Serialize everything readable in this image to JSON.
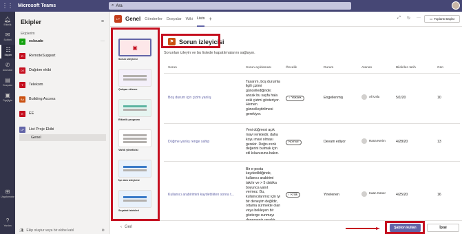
{
  "app": {
    "name": "Microsoft Teams",
    "search_value": "Ara",
    "accent": "#464775",
    "brand": "#6264a7"
  },
  "rail": [
    {
      "icon": "bell-icon",
      "label": "Etkinlik"
    },
    {
      "icon": "chat-icon",
      "label": "Sohbet"
    },
    {
      "icon": "teams-icon",
      "label": "Ekipler"
    },
    {
      "icon": "calls-icon",
      "label": "Aramalar"
    },
    {
      "icon": "files-icon",
      "label": "Dosyalar"
    },
    {
      "icon": "onenote-icon",
      "label": "OneNote"
    },
    {
      "icon": "apps-icon",
      "label": "Uygulamalar"
    },
    {
      "icon": "help-icon",
      "label": "Yardım"
    }
  ],
  "teams_panel": {
    "title": "Ekipler",
    "section": "Ekiplerim",
    "teams": [
      {
        "initials": "e",
        "name": "ecloude",
        "color": "#13a10e",
        "bold": true
      },
      {
        "initials": "R",
        "name": "RemoteSupport",
        "color": "#c50f1f",
        "bold": false
      },
      {
        "initials": "DE",
        "name": "Dağıtım ekibi",
        "color": "#c50f1f",
        "bold": false
      },
      {
        "initials": "T",
        "name": "Telekom",
        "color": "#c50f1f",
        "bold": false
      },
      {
        "initials": "BA",
        "name": "Building Access",
        "color": "#ca5010",
        "bold": false
      },
      {
        "initials": "E",
        "name": "EE",
        "color": "#c50f1f",
        "bold": false
      },
      {
        "initials": "LP",
        "name": "List Proje Ekibi",
        "color": "#6264a7",
        "bold": false
      }
    ],
    "channel": "Genel",
    "footer": "Ekip oluştur veya bir ekibe katıl"
  },
  "channel_header": {
    "logo": "LP",
    "title": "Genel",
    "tabs": [
      "Gönderiler",
      "Dosyalar",
      "Wiki",
      "Lists"
    ],
    "active_tab": "Lists",
    "meeting_button": "Toplantı Başlat"
  },
  "templates": [
    {
      "label": "Sorun izleyicisi",
      "selected": true
    },
    {
      "label": "Çalışan ekleme",
      "selected": false
    },
    {
      "label": "Etkinlik programı",
      "selected": false
    },
    {
      "label": "Varlık yöneticisi",
      "selected": false
    },
    {
      "label": "İşe alım izleyicisi",
      "selected": false
    },
    {
      "label": "Seyahat istekleri",
      "selected": false
    }
  ],
  "detail": {
    "title": "Sorun izleyicisi",
    "description": "Sorunları izleyin ve bu listede kapatılmalarını sağlayın.",
    "columns": [
      "Sorun",
      "Sorun açıklaması",
      "Öncelik",
      "Durum",
      "Atanan",
      "Bildirilen tarih",
      "Gün"
    ],
    "rows": [
      {
        "issue": "Boş durum için çizim yanlış",
        "desc": "Tasarım, boş durumla ilgili çizimi güncellediğinde; ancak bu sayfa hala eski çizimi gösteriyor. Hemen güncelleştirilmesi gerekiyor.",
        "priority": "Yüksek",
        "status": "Engellenmiş",
        "assignee": "Ali Uslu",
        "date": "5/1/20",
        "days": "10"
      },
      {
        "issue": "Düğme yanlış renge sahip",
        "desc": "Yeni düğmesi açık mavi renktedir, daha koyu mavi olması gerekir. Doğru renk değerini bulmak için stil kılavuzuna bakın.",
        "priority": "Normal",
        "status": "Devam ediyor",
        "assignee": "Rana Kerim",
        "date": "4/28/20",
        "days": "13"
      },
      {
        "issue": "Kullanıcı arabirimini kaydettikten sonra t...",
        "desc": "Bir e-posta kaydedildiğinde, kullanıcı arabirimi takılır ve > 5 dakika boyunca yanıt vermez. Bu, kullanıcılarımız için iyi bir deneyim değildir, ortama sürmekte olan veya bekleyen bir gösterge sunmayı denemeniz gerekir.",
        "priority": "Kritik",
        "status": "Yinelenen",
        "assignee": "Kaan Caner",
        "date": "4/25/20",
        "days": "16"
      }
    ]
  },
  "footer": {
    "back": "Geri",
    "use_template": "Şablon kullan",
    "cancel": "İptal"
  }
}
